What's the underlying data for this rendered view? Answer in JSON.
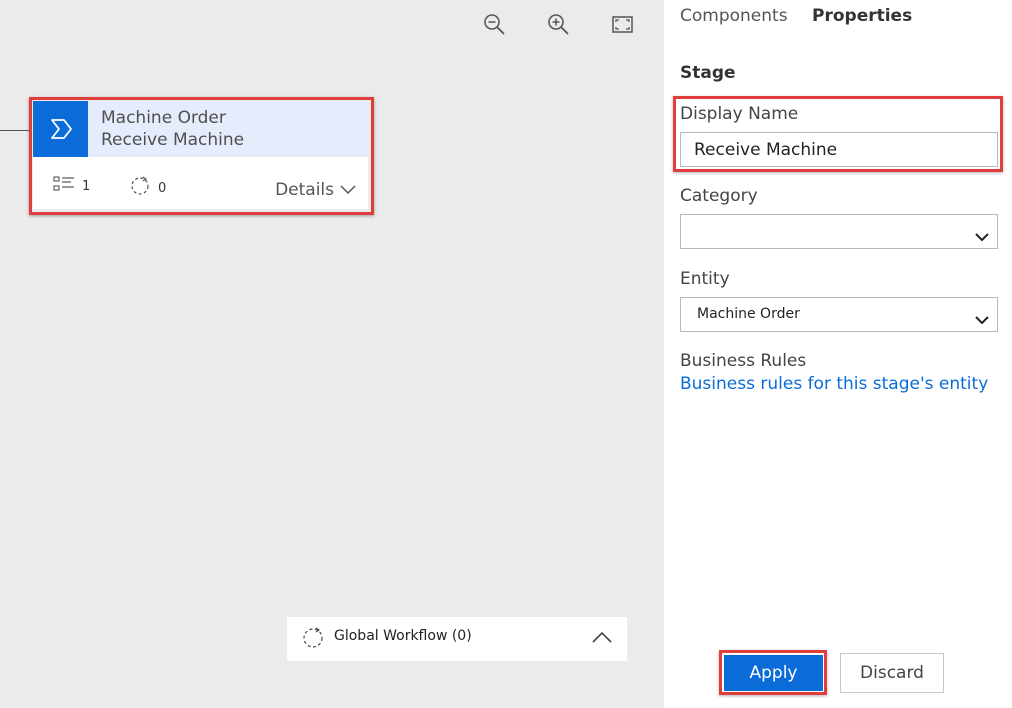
{
  "toolbar": {
    "zoom_out_icon": "zoom-out-icon",
    "zoom_in_icon": "zoom-in-icon",
    "fit_icon": "fit-to-screen-icon"
  },
  "stage_card": {
    "entity": "Machine Order",
    "name": "Receive Machine",
    "steps_count": "1",
    "workflows_count": "0",
    "details_label": "Details",
    "accent_color": "#0b6cd9",
    "highlight_color": "#e23d3d"
  },
  "global_workflow": {
    "label": "Global Workflow (0)"
  },
  "panel": {
    "tabs": [
      {
        "label": "Components",
        "active": false
      },
      {
        "label": "Properties",
        "active": true
      }
    ],
    "section_title": "Stage",
    "display_name": {
      "label": "Display Name",
      "value": "Receive Machine"
    },
    "category": {
      "label": "Category",
      "value": ""
    },
    "entity": {
      "label": "Entity",
      "value": "Machine Order"
    },
    "business_rules": {
      "label": "Business Rules",
      "link": "Business rules for this stage's entity"
    },
    "apply_label": "Apply",
    "discard_label": "Discard"
  }
}
